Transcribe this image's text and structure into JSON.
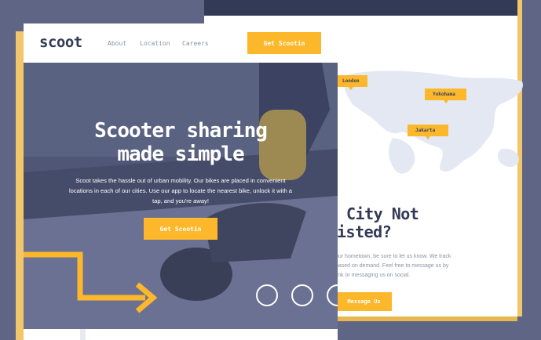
{
  "colors": {
    "accent": "#fcb72b",
    "navy": "#333a56",
    "grey": "#8e92a4",
    "background": "#5f6584"
  },
  "back_page": {
    "map_labels": [
      "London",
      "Yokohama",
      "Jakarta"
    ],
    "heading_lines": [
      "City Not",
      "isted?"
    ],
    "text_lines": [
      "our hometown, be sure to let us know. We track",
      "based on demand. Feel free to message us by",
      "link or messaging us on social."
    ],
    "button_label": "Message Us"
  },
  "front_page": {
    "logo": "scoot",
    "nav_links": [
      "About",
      "Location",
      "Careers"
    ],
    "nav_button": "Get Scootin",
    "hero": {
      "title_lines": [
        "Scooter sharing",
        "made simple"
      ],
      "subtitle": "Scoot takes the hassle out of urban mobility. Our bikes are placed in convenient locations in each of our cities. Use our app to locate the nearest bike, unlock it with a tap, and you're away!",
      "cta_label": "Get Scootin"
    }
  }
}
